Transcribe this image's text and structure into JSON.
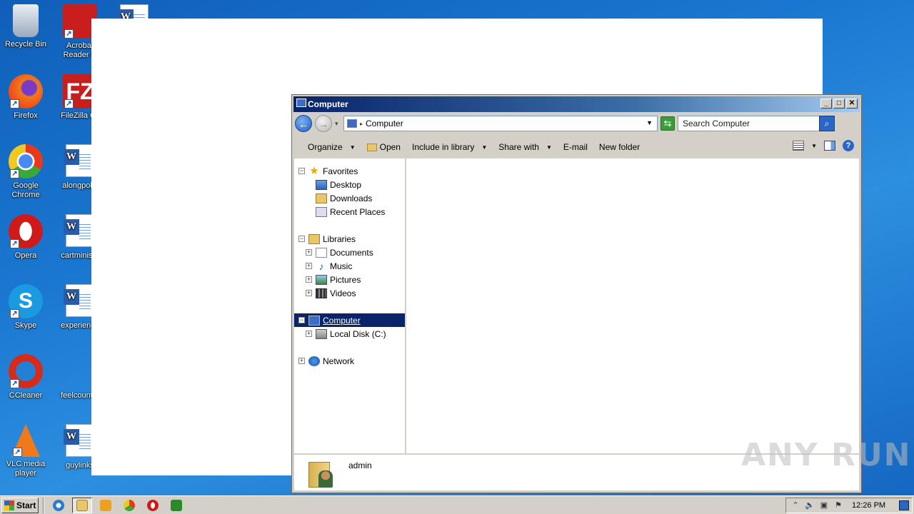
{
  "desktop": {
    "icons": [
      {
        "label": "Recycle Bin",
        "icon": "recycle-bin-icon"
      },
      {
        "label": "Acrobat Reader D",
        "icon": "acrobat-icon"
      },
      {
        "label": "Firefox",
        "icon": "firefox-icon"
      },
      {
        "label": "FileZilla Cli",
        "icon": "filezilla-icon"
      },
      {
        "label": "Google Chrome",
        "icon": "chrome-icon"
      },
      {
        "label": "alongpoliti",
        "icon": "word-doc-icon"
      },
      {
        "label": "Opera",
        "icon": "opera-icon"
      },
      {
        "label": "cartministe",
        "icon": "word-doc-icon"
      },
      {
        "label": "Skype",
        "icon": "skype-icon"
      },
      {
        "label": "experience",
        "icon": "word-doc-icon"
      },
      {
        "label": "CCleaner",
        "icon": "ccleaner-icon"
      },
      {
        "label": "feelcountry",
        "icon": "blank-file-icon"
      },
      {
        "label": "VLC media player",
        "icon": "vlc-icon"
      },
      {
        "label": "guylinks",
        "icon": "word-doc-icon"
      }
    ]
  },
  "explorer": {
    "title": "Computer",
    "address": "Computer",
    "search_placeholder": "Search Computer",
    "toolbar": {
      "organize": "Organize",
      "open": "Open",
      "include": "Include in library",
      "share": "Share with",
      "email": "E-mail",
      "newfolder": "New folder"
    },
    "nav": {
      "favorites": "Favorites",
      "desktop": "Desktop",
      "downloads": "Downloads",
      "recent": "Recent Places",
      "libraries": "Libraries",
      "documents": "Documents",
      "music": "Music",
      "pictures": "Pictures",
      "videos": "Videos",
      "computer": "Computer",
      "localdisk": "Local Disk (C:)",
      "network": "Network"
    },
    "details": {
      "name": "admin"
    }
  },
  "taskbar": {
    "start": "Start",
    "clock": "12:26 PM"
  },
  "watermark": "ANY RUN",
  "colors": {
    "selection": "#0a246a",
    "titlebar": "#0a246a",
    "desktop": "#1a77d0"
  }
}
